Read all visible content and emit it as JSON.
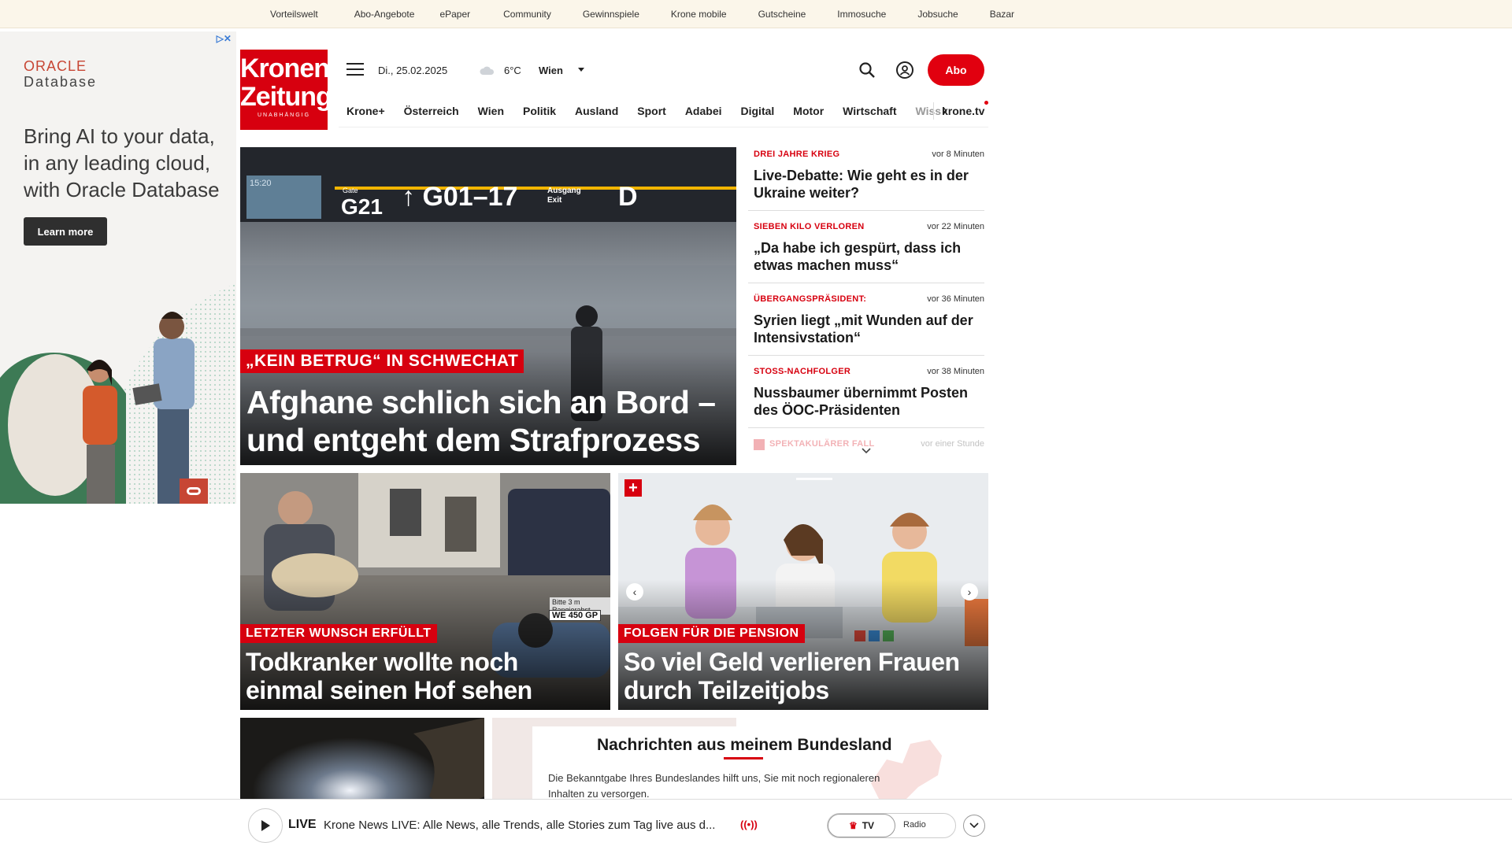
{
  "topbar": {
    "links": [
      "Vorteilswelt",
      "Abo-Angebote",
      "ePaper",
      "Community",
      "Gewinnspiele",
      "Krone mobile",
      "Gutscheine",
      "Immosuche",
      "Jobsuche",
      "Bazar"
    ]
  },
  "ad": {
    "brand_line1": "ORACLE",
    "brand_line2": "Database",
    "headline": "Bring AI to your data, in any leading cloud, with Oracle Database",
    "cta": "Learn more",
    "adchoices": "▷✕"
  },
  "header": {
    "logo_line1": "Kronen",
    "logo_line2": "Zeitung",
    "logo_sub": "UNABHÄNGIG",
    "date": "Di., 25.02.2025",
    "temperature": "6°C",
    "location": "Wien",
    "abo_label": "Abo"
  },
  "nav": {
    "items": [
      "Krone+",
      "Österreich",
      "Wien",
      "Politik",
      "Ausland",
      "Sport",
      "Adabei",
      "Digital",
      "Motor",
      "Wirtschaft"
    ],
    "overflow": "Wiss",
    "tv": "krone.tv"
  },
  "hero": {
    "kicker": "„KEIN BETRUG“ IN SCHWECHAT",
    "title": "Afghane schlich sich an Bord – und entgeht dem Strafprozess",
    "sign_time": "15:20",
    "sign_gate_label": "Gate",
    "sign_gate": "G21",
    "sign_range": "G01–17",
    "sign_exit": "Ausgang Exit",
    "sign_d": "D"
  },
  "news": [
    {
      "kicker": "DREI JAHRE KRIEG",
      "time": "vor 8 Minuten",
      "title": "Live-Debatte: Wie geht es in der Ukraine weiter?"
    },
    {
      "kicker": "SIEBEN KILO VERLOREN",
      "time": "vor 22 Minuten",
      "title": "„Da habe ich gespürt, dass ich etwas machen muss“"
    },
    {
      "kicker": "ÜBERGANGSPRÄSIDENT:",
      "time": "vor 36 Minuten",
      "title": "Syrien liegt „mit Wunden auf der Intensivstation“"
    },
    {
      "kicker": "STOSS-NACHFOLGER",
      "time": "vor 38 Minuten",
      "title": "Nussbaumer übernimmt Posten des ÖOC-Präsidenten"
    },
    {
      "kicker": "SPEKTAKULÄRER FALL",
      "time": "vor einer Stunde",
      "title": ""
    }
  ],
  "cards": [
    {
      "kicker": "LETZTER WUNSCH ERFÜLLT",
      "title": "Todkranker wollte noch einmal seinen Hof sehen",
      "plate": "WE 450 GP",
      "sign": "Bitte 3 m Rangierabst."
    },
    {
      "kicker": "FOLGEN FÜR DIE PENSION",
      "title": "So viel Geld verlieren Frauen durch Teilzeitjobs"
    }
  ],
  "bundesland": {
    "title": "Nachrichten aus meinem Bundesland",
    "desc": "Die Bekanntgabe Ihres Bundeslandes hilft uns, Sie mit noch regionaleren Inhalten zu versorgen."
  },
  "live": {
    "label": "LIVE",
    "text": "Krone News LIVE: Alle News, alle Trends, alle Stories zum Tag live aus d...",
    "radio_icon": "((•))",
    "tv": "TV",
    "radio": "Radio"
  },
  "colors": {
    "brand_red": "#d7000f",
    "topbar_bg": "#fbf6ea"
  }
}
